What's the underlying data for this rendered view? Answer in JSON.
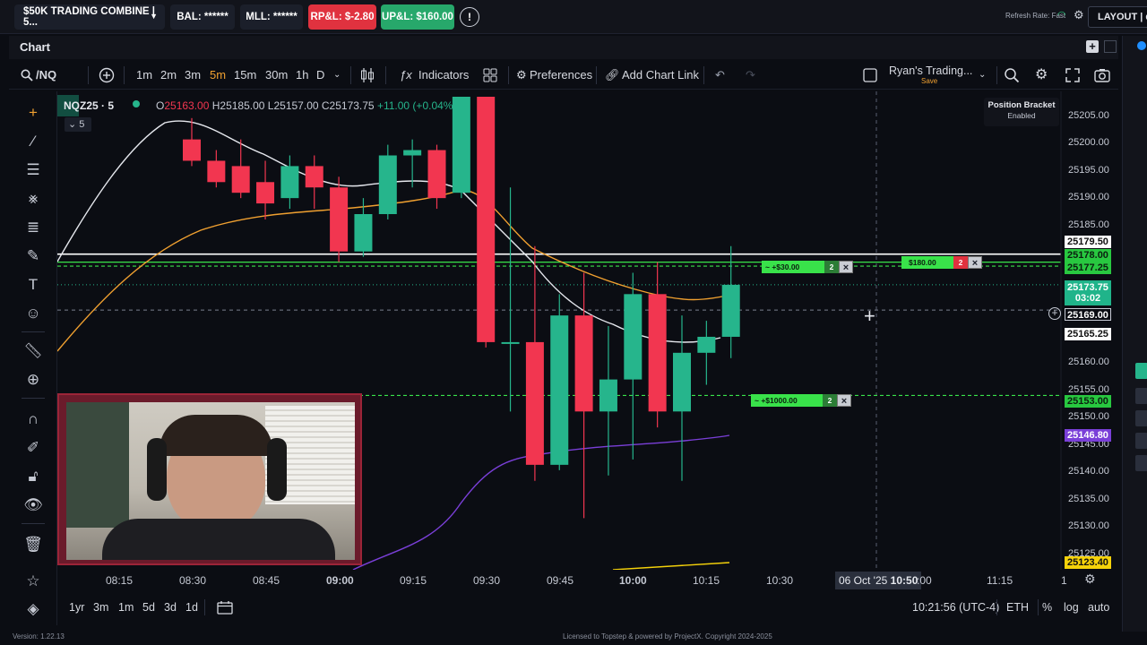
{
  "topbar": {
    "account": "$50K TRADING COMBINE | 5...",
    "bal": "BAL: ******",
    "mll": "MLL: ******",
    "rpl": "RP&L: $-2.80",
    "upl": "UP&L: $160.00",
    "refresh": "Refresh Rate: Fast",
    "layout": "LAYOUT | de"
  },
  "panel": {
    "title": "Chart"
  },
  "toolbar": {
    "symbol": "/NQ",
    "timeframes": [
      "1m",
      "2m",
      "3m",
      "5m",
      "15m",
      "30m",
      "1h",
      "D"
    ],
    "active_timeframe": "5m",
    "indicators": "Indicators",
    "preferences": "Preferences",
    "add_link": "Add Chart Link",
    "layout_name": "Ryan's Trading...",
    "save": "Save"
  },
  "legend": {
    "symbol": "NQZ25 · 5",
    "o": "25163.00",
    "h": "25185.00",
    "l": "25157.00",
    "c": "25173.75",
    "change": "+11.00 (+0.04%)",
    "sub": "5"
  },
  "position_bracket": {
    "title": "Position Bracket",
    "status": "Enabled"
  },
  "orders": [
    {
      "label": "~ +$30.00",
      "qty": "2"
    },
    {
      "label": "$180.00",
      "qty": "2"
    },
    {
      "label": "~ +$1000.00",
      "qty": "2"
    }
  ],
  "price_axis": {
    "labels": [
      "25205.00",
      "25200.00",
      "25195.00",
      "25190.00",
      "25185.00",
      "25160.00",
      "25155.00",
      "25150.00",
      "25145.00",
      "25140.00",
      "25135.00",
      "25130.00",
      "25125.00"
    ],
    "tags": {
      "white": "25179.50",
      "green1": "25178.00",
      "green2": "25177.25",
      "last": "25173.75",
      "timer": "03:02",
      "cursor": "25169.00",
      "gray": "25165.25",
      "green3": "25153.00",
      "purple": "25146.80",
      "yellow": "25123.40"
    }
  },
  "time_axis": {
    "labels": [
      "08:15",
      "08:30",
      "08:45",
      "09:00",
      "09:15",
      "09:30",
      "09:45",
      "10:00",
      "10:15",
      "10:30",
      "11:15",
      "1"
    ],
    "cursor_date": "06 Oct '25",
    "cursor_time": "10:50",
    "partial": ":00"
  },
  "bottom": {
    "ranges": [
      "1yr",
      "3m",
      "1m",
      "5d",
      "3d",
      "1d"
    ],
    "clock": "10:21:56 (UTC-4)",
    "session": "ETH",
    "pct": "%",
    "log": "log",
    "auto": "auto"
  },
  "footer": {
    "version": "Version: 1.22.13",
    "license": "Licensed to Topstep & powered by ProjectX. Copyright 2024-2025"
  },
  "colors": {
    "up": "#26b58c",
    "down": "#f23650",
    "accent_orange": "#f0a030",
    "order_green": "#39e24a",
    "purple": "#7a3fd8"
  },
  "chart_data": {
    "type": "candlestick",
    "y_range": [
      25121,
      25209
    ],
    "candles": [
      {
        "o": 25201,
        "h": 25205,
        "l": 25196,
        "c": 25197
      },
      {
        "o": 25197,
        "h": 25199,
        "l": 25192,
        "c": 25193
      },
      {
        "o": 25196,
        "h": 25201,
        "l": 25190,
        "c": 25191
      },
      {
        "o": 25193,
        "h": 25197,
        "l": 25186,
        "c": 25189
      },
      {
        "o": 25190,
        "h": 25198,
        "l": 25188,
        "c": 25196
      },
      {
        "o": 25196,
        "h": 25198,
        "l": 25188,
        "c": 25192
      },
      {
        "o": 25192,
        "h": 25194,
        "l": 25178,
        "c": 25180
      },
      {
        "o": 25180,
        "h": 25190,
        "l": 25179,
        "c": 25187
      },
      {
        "o": 25187,
        "h": 25200,
        "l": 25186,
        "c": 25198
      },
      {
        "o": 25198,
        "h": 25201,
        "l": 25192,
        "c": 25199
      },
      {
        "o": 25199,
        "h": 25200,
        "l": 25188,
        "c": 25190
      },
      {
        "o": 25191,
        "h": 25209,
        "l": 25190,
        "c": 25209
      },
      {
        "o": 25209,
        "h": 25209,
        "l": 25162,
        "c": 25163
      },
      {
        "o": 25163,
        "h": 25192,
        "l": 25150,
        "c": 25163
      },
      {
        "o": 25163,
        "h": 25181,
        "l": 25137,
        "c": 25140
      },
      {
        "o": 25140,
        "h": 25172,
        "l": 25139,
        "c": 25168
      },
      {
        "o": 25168,
        "h": 25176,
        "l": 25130,
        "c": 25150
      },
      {
        "o": 25150,
        "h": 25166,
        "l": 25138,
        "c": 25156
      },
      {
        "o": 25156,
        "h": 25176,
        "l": 25141,
        "c": 25172
      },
      {
        "o": 25172,
        "h": 25178,
        "l": 25147,
        "c": 25150
      },
      {
        "o": 25150,
        "h": 25168,
        "l": 25137,
        "c": 25161
      },
      {
        "o": 25161,
        "h": 25167,
        "l": 25155,
        "c": 25164
      },
      {
        "o": 25164,
        "h": 25181,
        "l": 25160,
        "c": 25173.75
      }
    ],
    "time_labels": [
      "08:15",
      "08:30",
      "08:45",
      "09:00",
      "09:15",
      "09:30",
      "09:45",
      "10:00",
      "10:15",
      "10:30"
    ],
    "bar_interval_minutes": 5,
    "horizontal_lines": [
      25179.5,
      25178,
      25177.25,
      25169,
      25153
    ],
    "last_price": 25173.75
  }
}
